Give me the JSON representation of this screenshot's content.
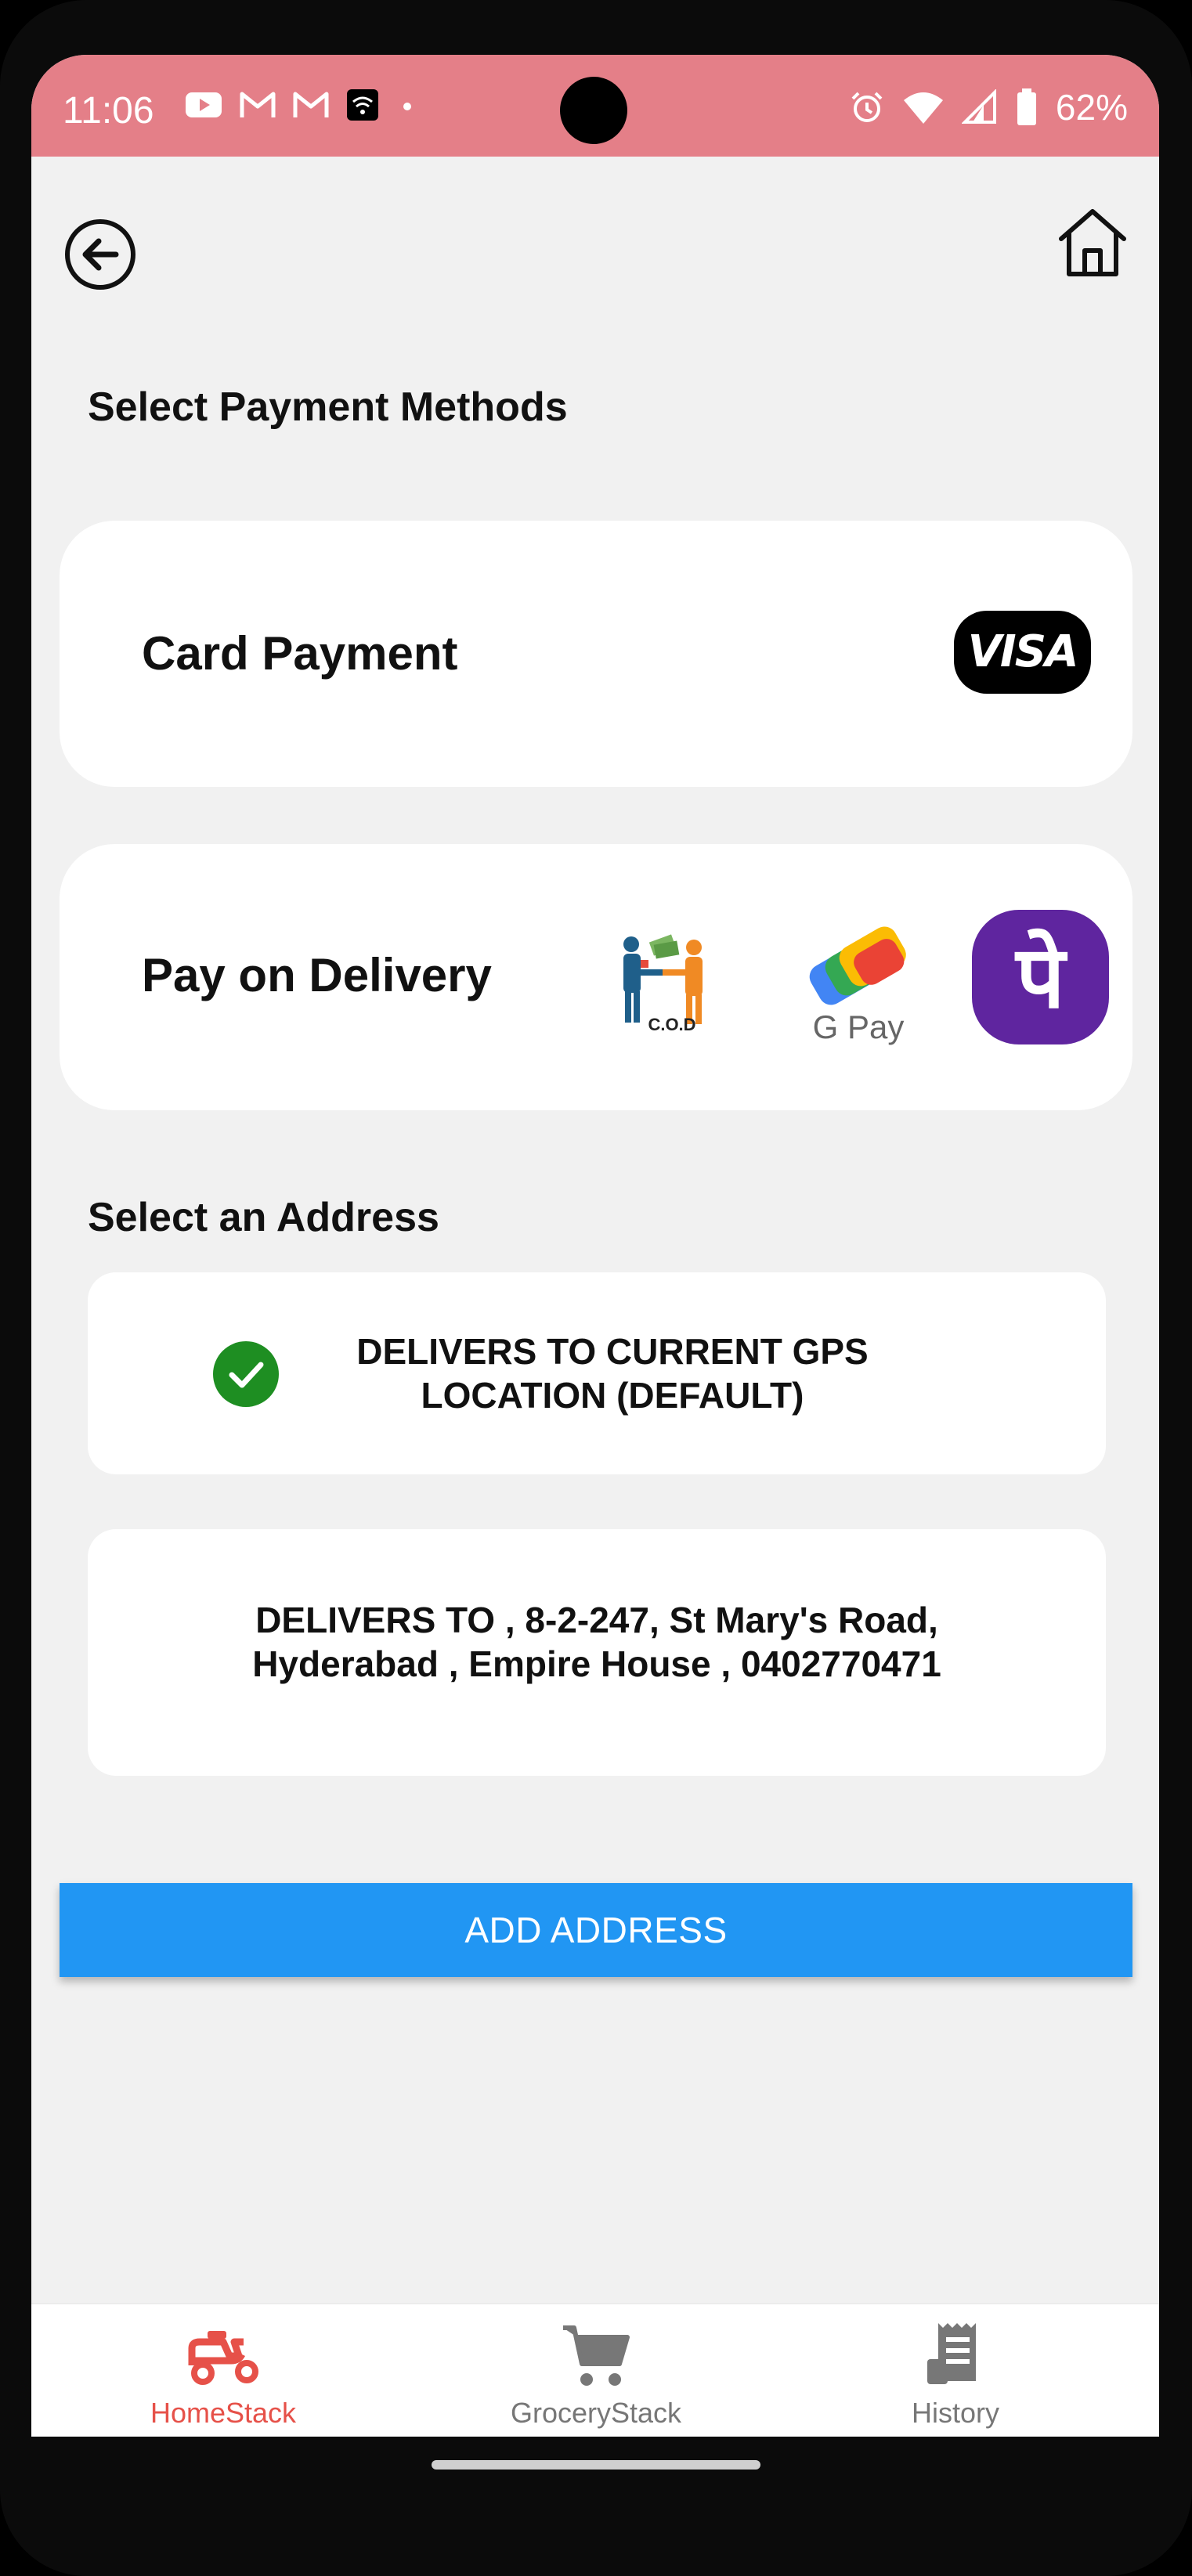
{
  "status_bar": {
    "time": "11:06",
    "battery": "62%",
    "icons_left": [
      "youtube-icon",
      "gmail-icon",
      "gmail-icon",
      "wifi-calling-icon",
      "dot-icon"
    ],
    "icons_right": [
      "alarm-icon",
      "wifi-icon",
      "signal-icon",
      "battery-icon"
    ],
    "color": "#e47f88"
  },
  "header": {
    "back_icon": "arrow-left-circle-icon",
    "home_icon": "home-icon"
  },
  "payment": {
    "title": "Select Payment Methods",
    "card_payment": {
      "label": "Card Payment",
      "brand": "VISA"
    },
    "pay_on_delivery": {
      "label": "Pay on Delivery",
      "methods": [
        {
          "name": "cod",
          "text": "C.O.D"
        },
        {
          "name": "gpay",
          "text": "G Pay"
        },
        {
          "name": "phonepe",
          "text": "पे"
        }
      ]
    }
  },
  "address": {
    "title": "Select an Address",
    "items": [
      {
        "text": "DELIVERS TO CURRENT GPS LOCATION (DEFAULT)",
        "selected": true
      },
      {
        "text": "DELIVERS TO , 8-2-247, St Mary's Road, Hyderabad , Empire House , 0402770471",
        "selected": false
      }
    ],
    "add_button": "ADD ADDRESS"
  },
  "bottom_nav": {
    "items": [
      {
        "label": "HomeStack",
        "icon": "scooter-icon",
        "active": true
      },
      {
        "label": "GroceryStack",
        "icon": "cart-icon",
        "active": false
      },
      {
        "label": "History",
        "icon": "receipt-icon",
        "active": false
      }
    ],
    "active_color": "#e65149",
    "inactive_color": "#777777"
  },
  "accent_color": "#2196f3"
}
